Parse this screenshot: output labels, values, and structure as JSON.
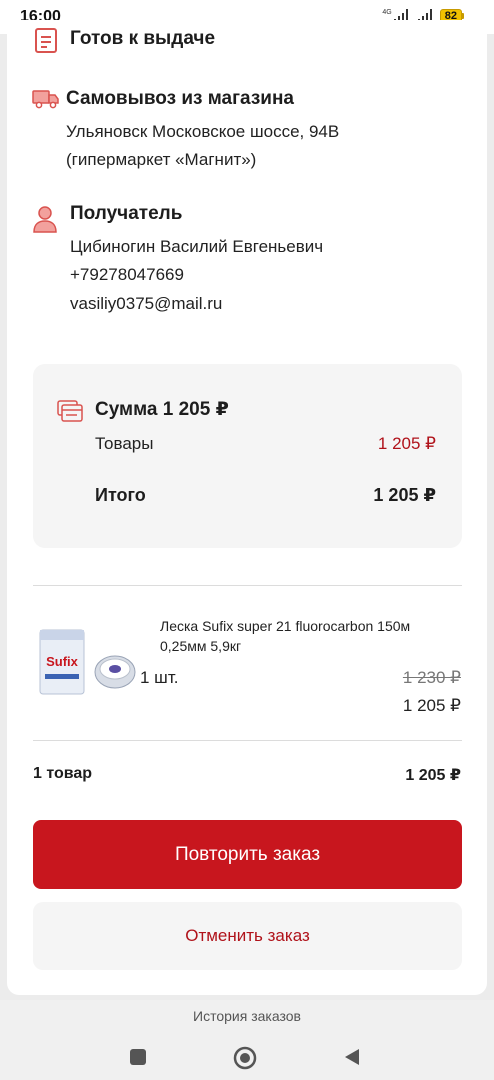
{
  "status_bar": {
    "time": "16:00",
    "network": "4G",
    "battery": "82"
  },
  "order": {
    "status_label": "Готов к выдаче",
    "delivery": {
      "title": "Самовывоз из магазина",
      "address_line1": "Ульяновск Московское шоссе, 94В",
      "address_line2": "(гипермаркет «Магнит»)"
    },
    "recipient": {
      "title": "Получатель",
      "name": "Цибиногин Василий Евгеньевич",
      "phone": "+79278047669",
      "email": "vasiliy0375@mail.ru"
    },
    "summary": {
      "title": "Сумма 1 205 ₽",
      "goods_label": "Товары",
      "goods_value": "1 205 ₽",
      "total_label": "Итого",
      "total_value": "1 205 ₽"
    },
    "item": {
      "name_line1": "Леска Sufix super 21 fluorocarbon 150м",
      "name_line2": "0,25мм 5,9кг",
      "quantity": "1 шт.",
      "old_price": "1 230 ₽",
      "price": "1 205 ₽",
      "image_label": "Sufix"
    },
    "items_count_label": "1 товар",
    "items_total": "1 205 ₽",
    "repeat_button": "Повторить заказ",
    "cancel_button": "Отменить заказ"
  },
  "bottom_nav": {
    "label": "История заказов"
  },
  "colors": {
    "accent": "#c8161e",
    "icon": "#d9534f"
  }
}
